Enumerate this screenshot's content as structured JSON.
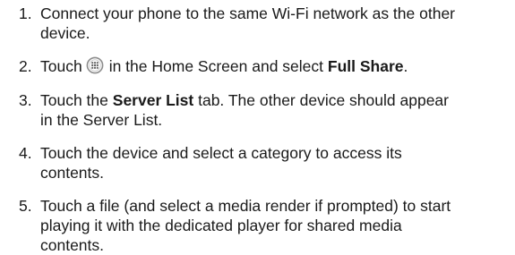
{
  "steps": [
    {
      "number": "1.",
      "line1": "Connect your phone to the same Wi-Fi network as the other",
      "line2": "device."
    },
    {
      "number": "2.",
      "before_icon": "Touch",
      "icon": "apps-grid-icon",
      "after_icon": "in the Home Screen and select",
      "bold": "Full Share",
      "end": "."
    },
    {
      "number": "3.",
      "before_bold": "Touch the",
      "bold": "Server List",
      "after_bold": "tab. The other device should appear",
      "line2": "in the Server List."
    },
    {
      "number": "4.",
      "line1": "Touch the device and select a category to access its",
      "line2": "contents."
    },
    {
      "number": "5.",
      "line1": "Touch a file (and select a media render if prompted) to start",
      "line2": "playing it with the dedicated player for shared media",
      "line3": "contents."
    }
  ],
  "colors": {
    "text": "#1a1a1a",
    "icon_ring": "#8c8c8c"
  }
}
